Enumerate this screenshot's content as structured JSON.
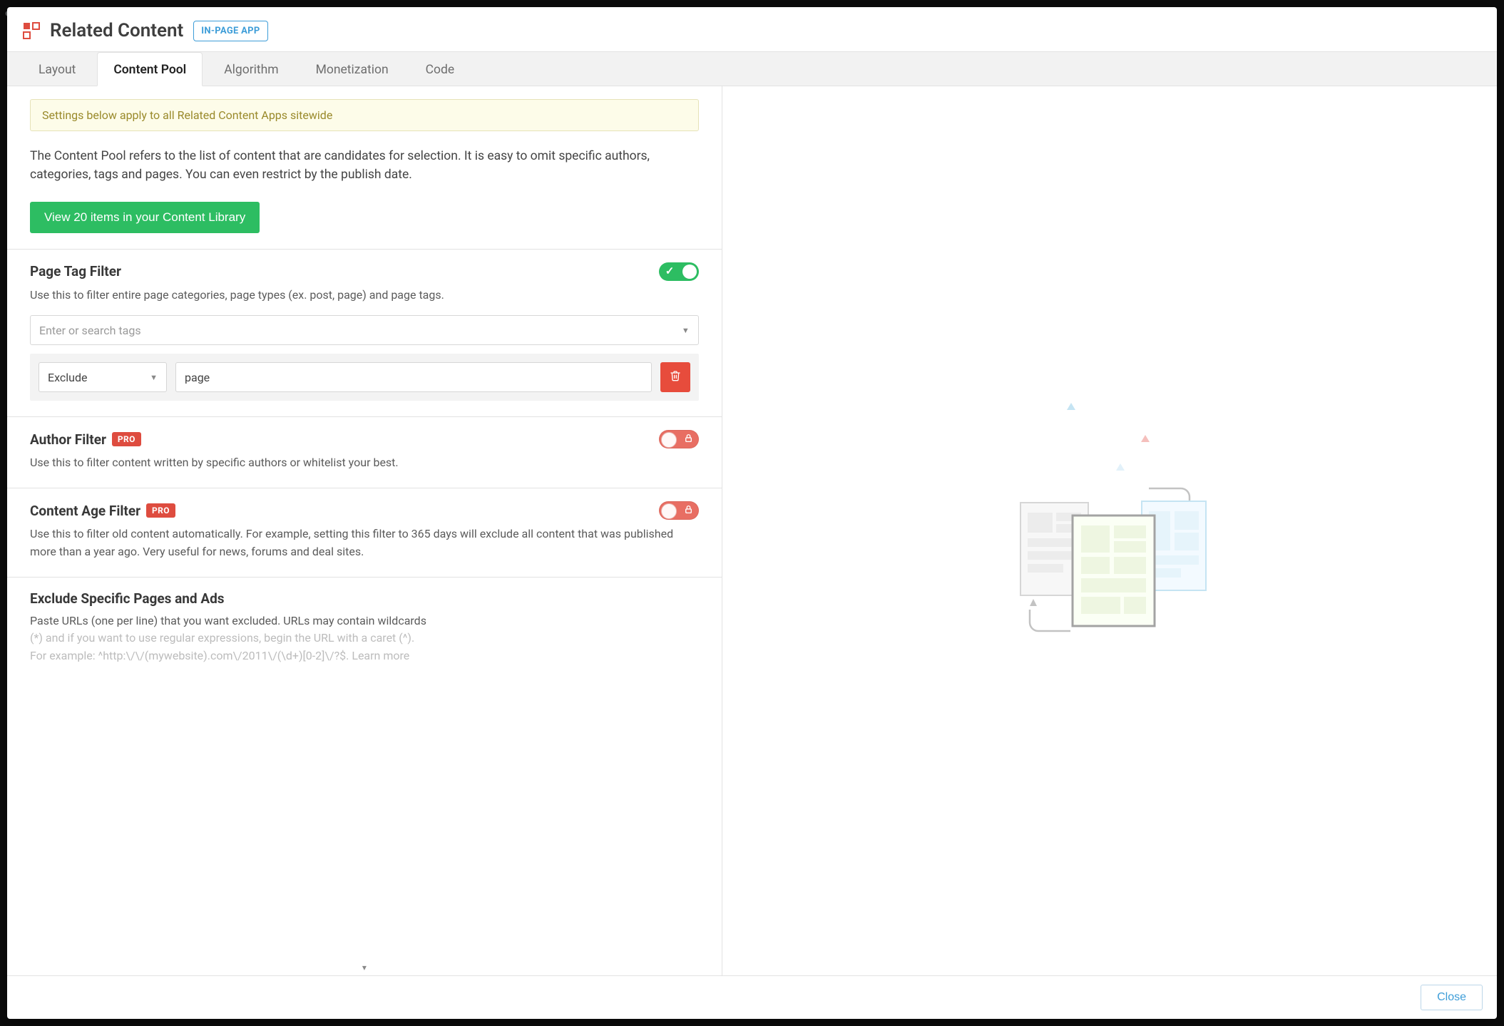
{
  "header": {
    "title": "Related Content",
    "badge": "IN-PAGE APP"
  },
  "tabs": [
    {
      "label": "Layout",
      "active": false
    },
    {
      "label": "Content Pool",
      "active": true
    },
    {
      "label": "Algorithm",
      "active": false
    },
    {
      "label": "Monetization",
      "active": false
    },
    {
      "label": "Code",
      "active": false
    }
  ],
  "notice": "Settings below apply to all Related Content Apps sitewide",
  "intro": "The Content Pool refers to the list of content that are candidates for selection. It is easy to omit specific authors, categories, tags and pages. You can even restrict by the publish date.",
  "library_button": "View 20 items in your Content Library",
  "page_tag_filter": {
    "title": "Page Tag Filter",
    "desc": "Use this to filter entire page categories, page types (ex. post, page) and page tags.",
    "input_placeholder": "Enter or search tags",
    "rule_mode": "Exclude",
    "rule_value": "page"
  },
  "author_filter": {
    "title": "Author Filter",
    "pro": "PRO",
    "desc": "Use this to filter content written by specific authors or whitelist your best."
  },
  "content_age_filter": {
    "title": "Content Age Filter",
    "pro": "PRO",
    "desc": "Use this to filter old content automatically. For example, setting this filter to 365 days will exclude all content that was published more than a year ago. Very useful for news, forums and deal sites."
  },
  "exclude_pages": {
    "title": "Exclude Specific Pages and Ads",
    "desc_line1": "Paste URLs (one per line) that you want excluded. URLs may contain wildcards",
    "desc_line2": "(*) and if you want to use regular expressions, begin the URL with a caret (^).",
    "desc_line3": "For example: ^http:\\/\\/(mywebsite).com\\/2011\\/(\\d+)[0-2]\\/?$. Learn more"
  },
  "footer": {
    "close": "Close"
  }
}
